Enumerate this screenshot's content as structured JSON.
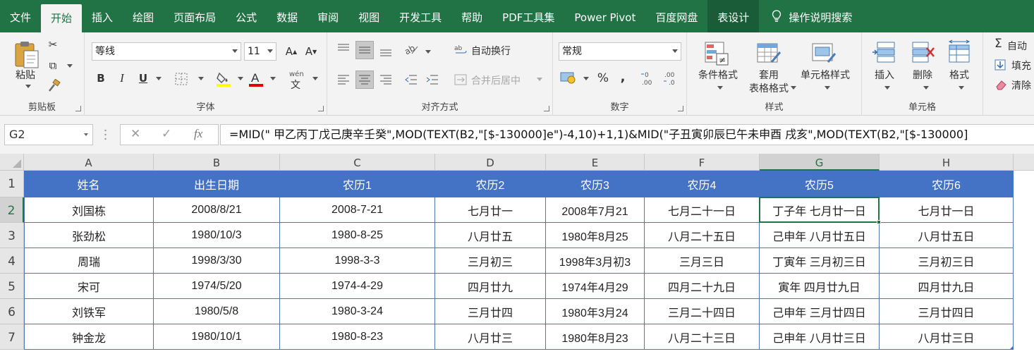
{
  "menu": {
    "tabs": [
      "文件",
      "开始",
      "插入",
      "绘图",
      "页面布局",
      "公式",
      "数据",
      "审阅",
      "视图",
      "开发工具",
      "帮助",
      "PDF工具集",
      "Power Pivot",
      "百度网盘",
      "表设计"
    ],
    "active": "开始",
    "search": "操作说明搜索"
  },
  "ribbon": {
    "clipboard": {
      "paste": "粘贴",
      "label": "剪贴板"
    },
    "font": {
      "name": "等线",
      "size": "11",
      "bold": "B",
      "italic": "I",
      "underline": "U",
      "label": "字体",
      "pinyin": "wén"
    },
    "alignment": {
      "wrap": "自动换行",
      "merge": "合并后居中",
      "label": "对齐方式"
    },
    "number": {
      "format": "常规",
      "percent": "%",
      "comma": ",",
      "label": "数字"
    },
    "styles": {
      "conditional": "条件格式",
      "table_fmt_1": "套用",
      "table_fmt_2": "表格格式",
      "cell_styles": "单元格样式",
      "label": "样式"
    },
    "cells": {
      "insert": "插入",
      "delete": "删除",
      "format": "格式",
      "label": "单元格"
    },
    "editing": {
      "autosum": "自动",
      "fill": "填充",
      "clear": "清除"
    }
  },
  "formula_bar": {
    "name_box": "G2",
    "fx": "fx",
    "formula": "=MID(\" 甲乙丙丁戊己庚辛壬癸\",MOD(TEXT(B2,\"[$-130000]e\")-4,10)+1,1)&MID(\"子丑寅卯辰巳午未申酉 戌亥\",MOD(TEXT(B2,\"[$-130000]"
  },
  "sheet": {
    "columns": [
      "A",
      "B",
      "C",
      "D",
      "E",
      "F",
      "G",
      "H"
    ],
    "rows": [
      "1",
      "2",
      "3",
      "4",
      "5",
      "6",
      "7"
    ],
    "selected_cell": "G2",
    "headers": [
      "姓名",
      "出生日期",
      "农历1",
      "农历2",
      "农历3",
      "农历4",
      "农历5",
      "农历6"
    ],
    "data": [
      [
        "刘国栋",
        "2008/8/21",
        "2008-7-21",
        "七月廿一",
        "2008年7月21",
        "七月二十一日",
        "丁子年 七月廿一日",
        "七月廿一日"
      ],
      [
        "张劲松",
        "1980/10/3",
        "1980-8-25",
        "八月廿五",
        "1980年8月25",
        "八月二十五日",
        "己申年 八月廿五日",
        "八月廿五日"
      ],
      [
        "周瑞",
        "1998/3/30",
        "1998-3-3",
        "三月初三",
        "1998年3月初3",
        "三月三日",
        "丁寅年 三月初三日",
        "三月初三日"
      ],
      [
        "宋可",
        "1974/5/20",
        "1974-4-29",
        "四月廿九",
        "1974年4月29",
        "四月二十九日",
        "寅年 四月廿九日",
        "四月廿九日"
      ],
      [
        "刘铁军",
        "1980/5/8",
        "1980-3-24",
        "三月廿四",
        "1980年3月24",
        "三月二十四日",
        "己申年 三月廿四日",
        "三月廿四日"
      ],
      [
        "钟金龙",
        "1980/10/1",
        "1980-8-23",
        "八月廿三",
        "1980年8月23",
        "八月二十三日",
        "己申年 八月廿三日",
        "八月廿三日"
      ]
    ]
  },
  "colors": {
    "excel_green": "#217346",
    "table_header": "#4472c4",
    "table_border": "#4f74b8"
  }
}
